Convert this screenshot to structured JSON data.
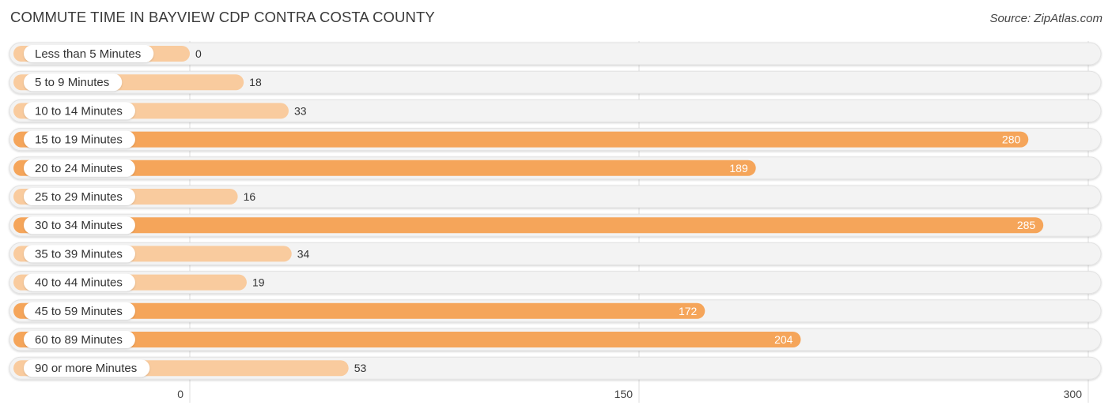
{
  "title": "COMMUTE TIME IN BAYVIEW CDP CONTRA COSTA COUNTY",
  "source": "Source: ZipAtlas.com",
  "colors": {
    "bar_strong": "#F5A55A",
    "bar_light": "#F9CB9E",
    "track": "#F3F3F3",
    "label_inside": "#FFFFFF",
    "label_outside": "#333333"
  },
  "chart_data": {
    "type": "bar",
    "orientation": "horizontal",
    "title": "COMMUTE TIME IN BAYVIEW CDP CONTRA COSTA COUNTY",
    "xlabel": "",
    "ylabel": "",
    "categories": [
      "Less than 5 Minutes",
      "5 to 9 Minutes",
      "10 to 14 Minutes",
      "15 to 19 Minutes",
      "20 to 24 Minutes",
      "25 to 29 Minutes",
      "30 to 34 Minutes",
      "35 to 39 Minutes",
      "40 to 44 Minutes",
      "45 to 59 Minutes",
      "60 to 89 Minutes",
      "90 or more Minutes"
    ],
    "values": [
      0,
      18,
      33,
      280,
      189,
      16,
      285,
      34,
      19,
      172,
      204,
      53
    ],
    "xlim": [
      0,
      300
    ],
    "xticks": [
      0,
      150,
      300
    ],
    "grid": true,
    "legend": "none"
  }
}
